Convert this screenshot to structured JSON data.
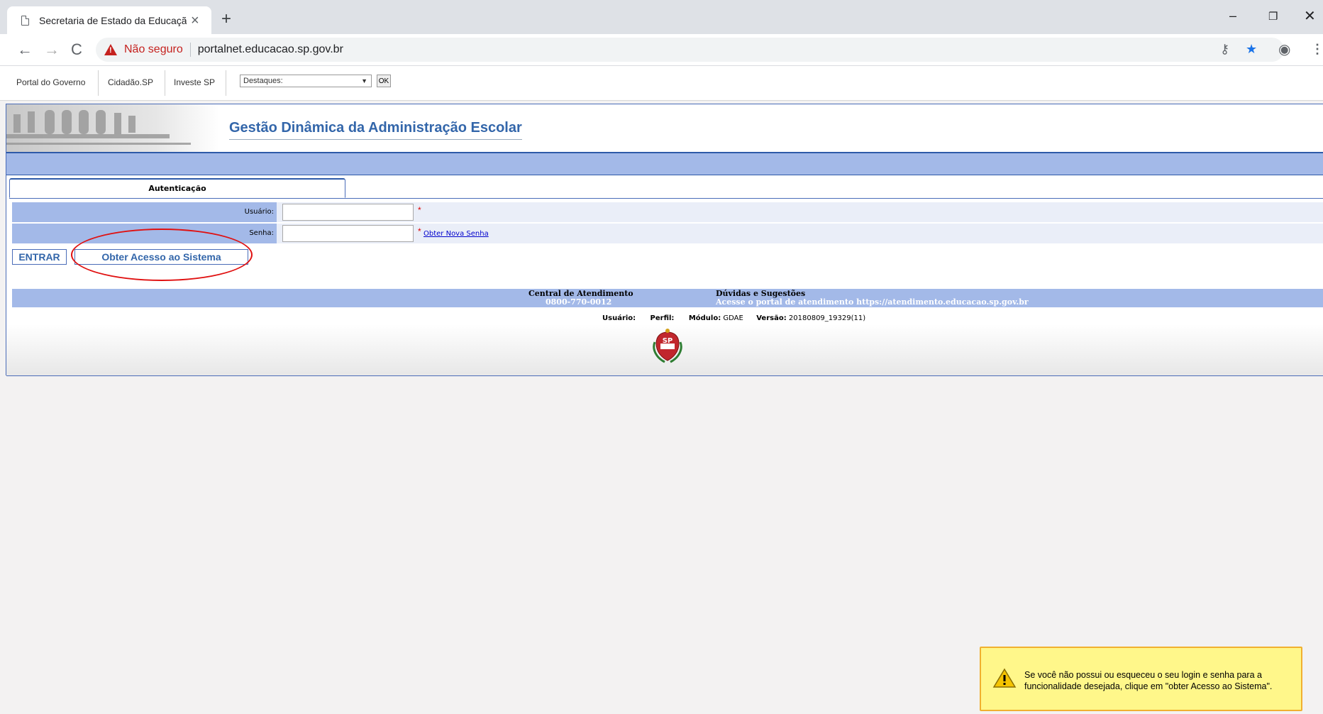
{
  "browser": {
    "tab_title": "Secretaria de Estado da Educação",
    "security_label": "Não seguro",
    "url": "portalnet.educacao.sp.gov.br"
  },
  "portal_bar": {
    "links": [
      "Portal do Governo",
      "Cidadão.SP",
      "Investe SP"
    ],
    "destaques_value": "Destaques:",
    "ok_label": "OK"
  },
  "app": {
    "title": "Gestão Dinâmica da Administração Escolar",
    "tab_label": "Autenticação",
    "usuario_label": "Usuário:",
    "usuario_value": "",
    "senha_label": "Senha:",
    "senha_value": "",
    "required_mark": "*",
    "obter_nova_senha": "Obter Nova Senha",
    "entrar_label": "ENTRAR",
    "obter_acesso_label": "Obter Acesso ao Sistema"
  },
  "footer": {
    "central_title": "Central de Atendimento",
    "central_phone": "0800-770-0012",
    "duvidas_title": "Dúvidas e Sugestões",
    "duvidas_text": "Acesse o portal de atendimento https://atendimento.educacao.sp.gov.br",
    "usuario_label": "Usuário:",
    "perfil_label": "Perfil:",
    "modulo_label": "Módulo:",
    "modulo_value": "GDAE",
    "versao_label": "Versão:",
    "versao_value": "20180809_19329(11)"
  },
  "notification": {
    "line1": "Se você não possui ou esqueceu o seu login e senha para a",
    "line2": "funcionalidade desejada, clique em \"obter Acesso ao Sistema\"."
  },
  "icons": [
    "document-icon",
    "close-icon",
    "plus-icon",
    "back-icon",
    "forward-icon",
    "reload-icon",
    "warning-icon",
    "key-icon",
    "star-icon",
    "account-icon",
    "menu-icon",
    "minimize-icon",
    "restore-icon",
    "window-close-icon",
    "sp-emblem-icon"
  ],
  "colors": {
    "band_blue": "#a3b9e8",
    "title_blue": "#3366aa",
    "alert_yellow": "#fff78a",
    "highlight_red": "#e01010"
  }
}
